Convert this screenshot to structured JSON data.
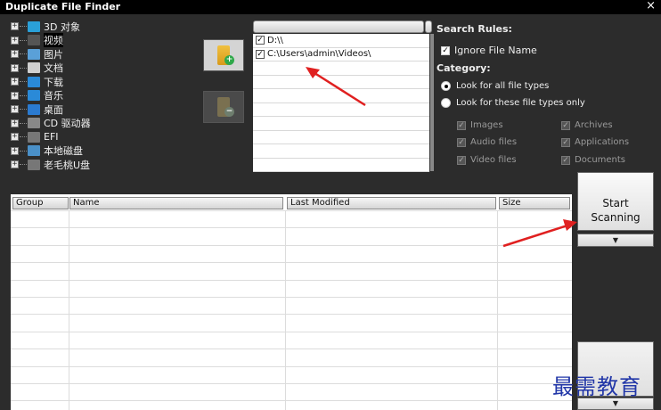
{
  "window": {
    "title": "Duplicate File Finder",
    "close_glyph": "×"
  },
  "tree": {
    "items": [
      {
        "label": "3D 对象",
        "icon": "3d-objects-icon",
        "color": "#2aa0d8",
        "selected": false
      },
      {
        "label": "视频",
        "icon": "video-folder-icon",
        "color": "#555555",
        "selected": true
      },
      {
        "label": "图片",
        "icon": "pictures-folder-icon",
        "color": "#5aa0d8",
        "selected": false
      },
      {
        "label": "文档",
        "icon": "documents-folder-icon",
        "color": "#d0d0d0",
        "selected": false
      },
      {
        "label": "下载",
        "icon": "downloads-folder-icon",
        "color": "#2a8ad8",
        "selected": false
      },
      {
        "label": "音乐",
        "icon": "music-folder-icon",
        "color": "#2a8ad8",
        "selected": false
      },
      {
        "label": "桌面",
        "icon": "desktop-folder-icon",
        "color": "#2a7ad0",
        "selected": false
      },
      {
        "label": "CD 驱动器",
        "icon": "cd-drive-icon",
        "color": "#888888",
        "selected": false
      },
      {
        "label": "EFI",
        "icon": "drive-icon",
        "color": "#777777",
        "selected": false
      },
      {
        "label": "本地磁盘",
        "icon": "local-disk-icon",
        "color": "#4a90c8",
        "selected": false
      },
      {
        "label": "老毛桃U盘",
        "icon": "usb-drive-icon",
        "color": "#777777",
        "selected": false
      }
    ]
  },
  "buttons": {
    "add_badge": "+",
    "remove_badge": "−"
  },
  "folders": [
    {
      "path": "D:\\\\",
      "checked": true,
      "check_glyph": "✓"
    },
    {
      "path": "C:\\Users\\admin\\Videos\\",
      "checked": true,
      "check_glyph": "✓"
    }
  ],
  "rules": {
    "heading": "Search Rules:",
    "ignore_file_name": "Ignore File Name",
    "category_heading": "Category:",
    "all_types": "Look for all file types",
    "these_types": "Look for these file types only",
    "check_glyph": "✓",
    "types": [
      "Images",
      "Archives",
      "Audio files",
      "Applications",
      "Video files",
      "Documents"
    ]
  },
  "results": {
    "columns": [
      "Group",
      "Name",
      "Last Modified",
      "Size"
    ]
  },
  "scan": {
    "line1": "Start",
    "line2": "Scanning",
    "drop_glyph": "▼"
  },
  "watermark": "最需教育",
  "colors": {
    "arrow": "#e02020",
    "watermark": "#2237a8"
  }
}
